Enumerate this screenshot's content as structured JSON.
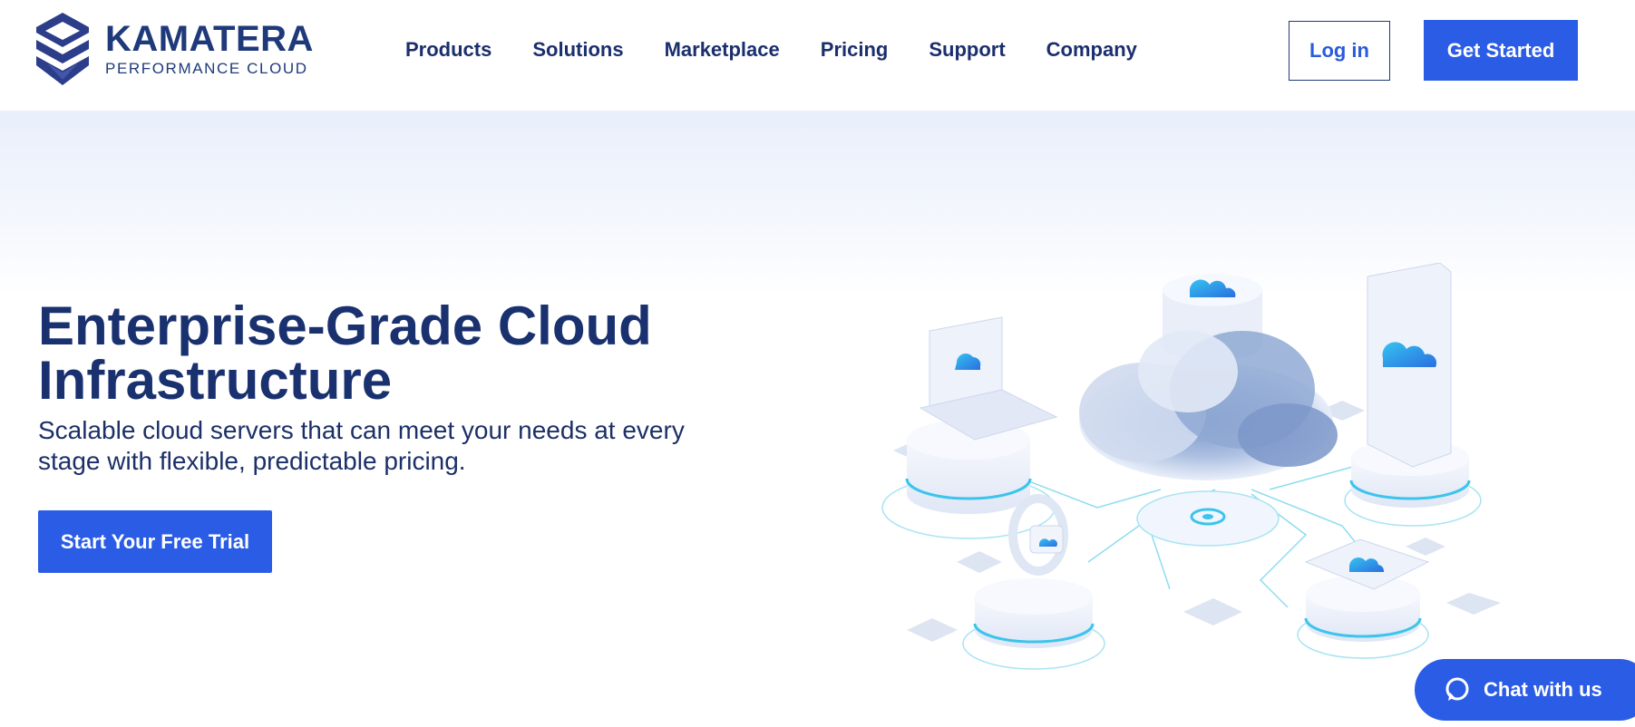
{
  "brand": {
    "name": "KAMATERA",
    "tagline": "PERFORMANCE CLOUD"
  },
  "nav": {
    "items": [
      {
        "label": "Products"
      },
      {
        "label": "Solutions"
      },
      {
        "label": "Marketplace"
      },
      {
        "label": "Pricing"
      },
      {
        "label": "Support"
      },
      {
        "label": "Company"
      }
    ]
  },
  "header": {
    "login_label": "Log in",
    "get_started_label": "Get Started"
  },
  "hero": {
    "title": "Enterprise-Grade Cloud Infrastructure",
    "subtitle": "Scalable cloud servers that can meet your needs at every stage with flexible, predictable pricing.",
    "cta_label": "Start Your Free Trial"
  },
  "chat": {
    "label": "Chat with us"
  },
  "colors": {
    "primary": "#2b5ce6",
    "navy": "#1a3170",
    "accent_cyan": "#2ec6ea"
  }
}
